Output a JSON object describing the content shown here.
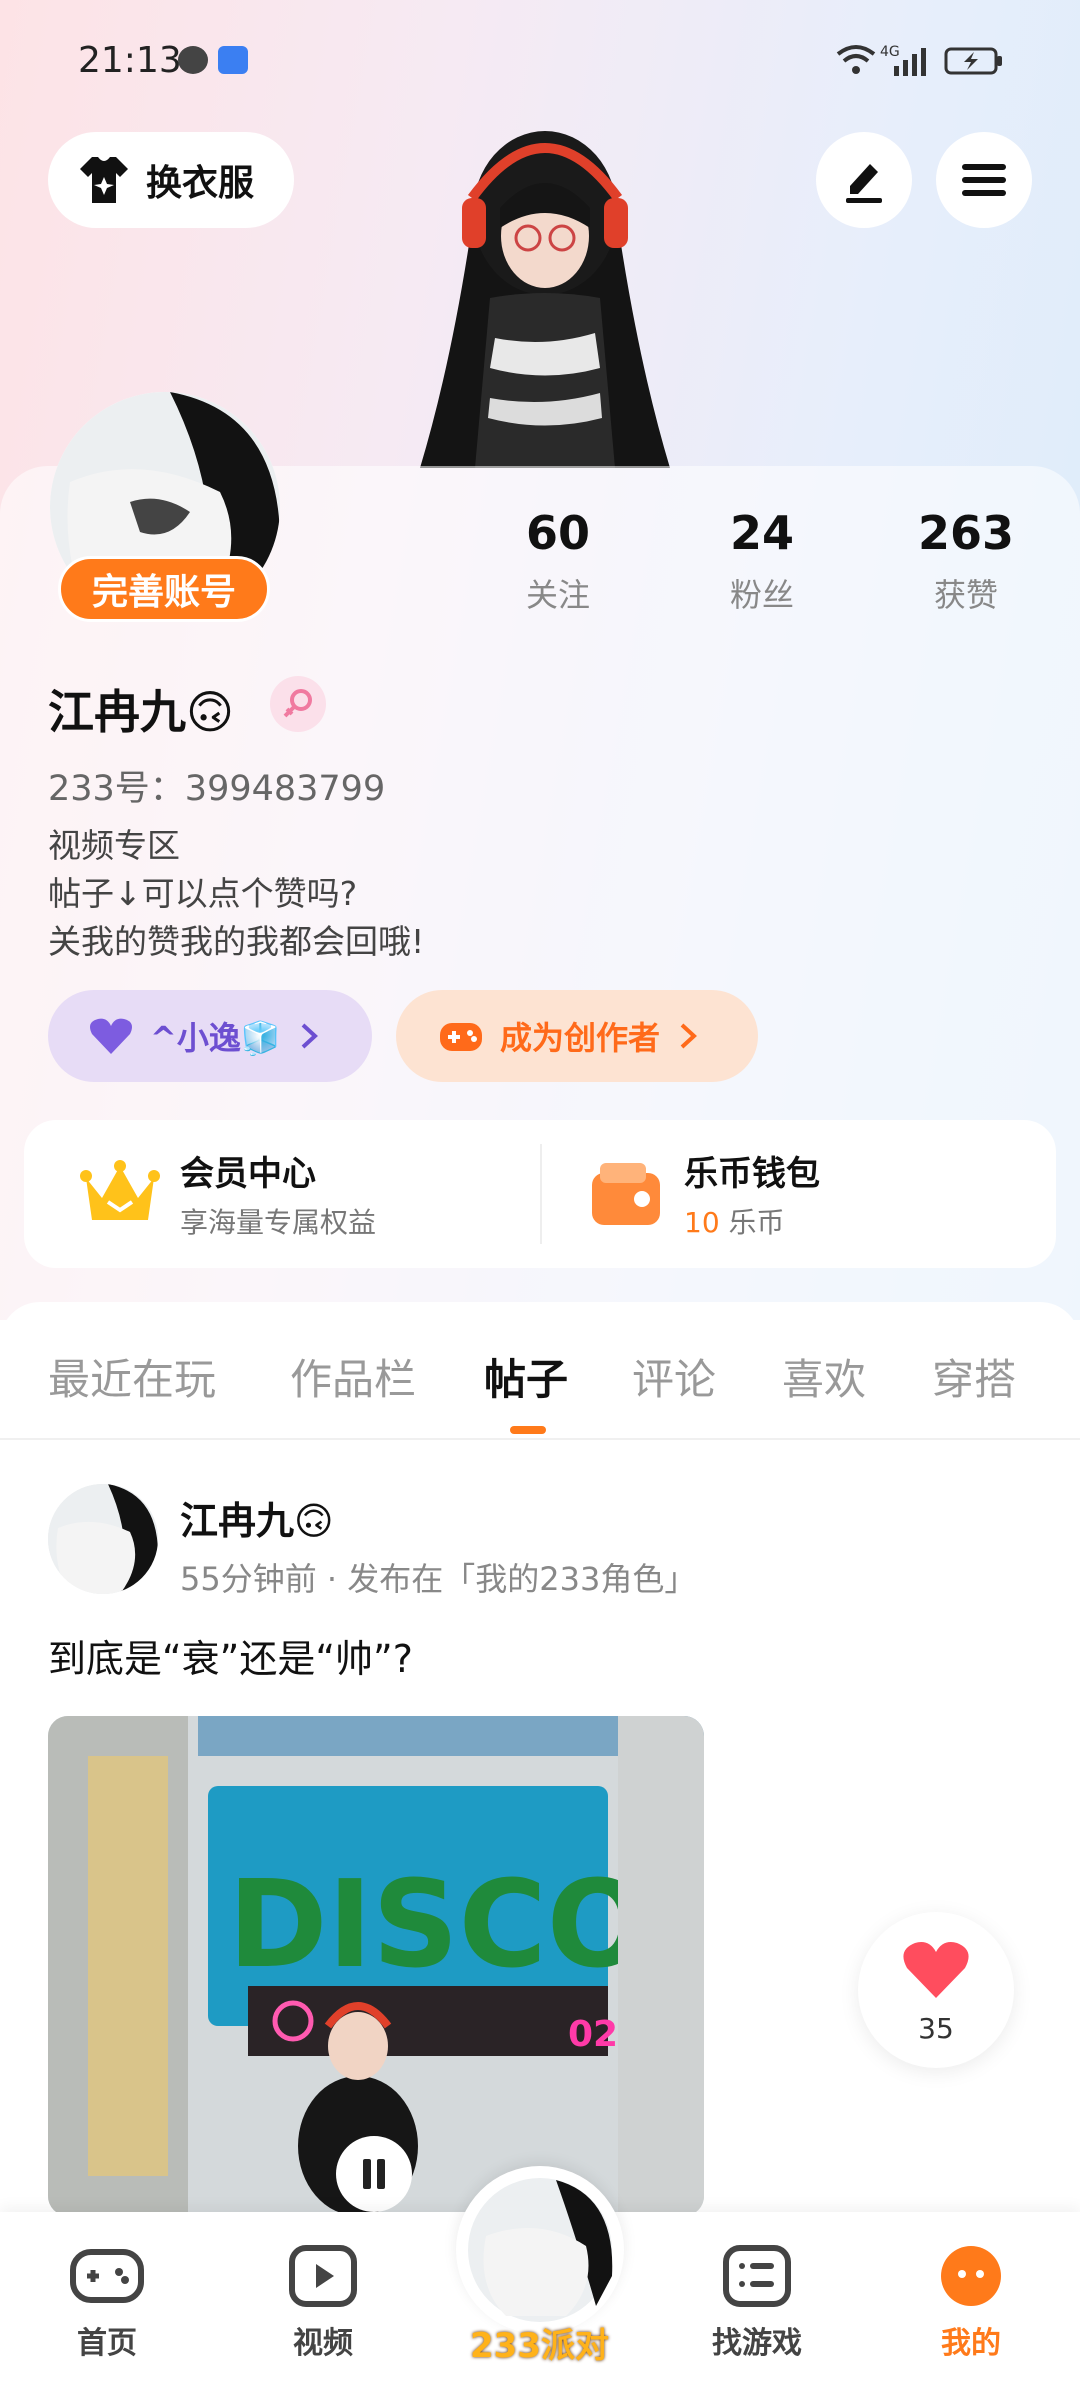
{
  "status_bar": {
    "time": "21:13",
    "network": "4G"
  },
  "header": {
    "outfit_label": "换衣服"
  },
  "profile": {
    "complete_label": "完善账号",
    "stats": [
      {
        "num": "60",
        "label": "关注"
      },
      {
        "num": "24",
        "label": "粉丝"
      },
      {
        "num": "263",
        "label": "获赞"
      }
    ],
    "name": "江冉九🙃",
    "uid": "233号：399483799",
    "bio": [
      "视频专区",
      "帖子↓可以点个赞吗?",
      "关我的赞我的我都会回哦!"
    ],
    "fan_badge": "^小逸🧊",
    "creator_label": "成为创作者"
  },
  "vip": {
    "member_title": "会员中心",
    "member_sub": "享海量专属权益",
    "wallet_title": "乐币钱包",
    "wallet_amount": "10",
    "wallet_unit": " 乐币"
  },
  "tabs": [
    "最近在玩",
    "作品栏",
    "帖子",
    "评论",
    "喜欢",
    "穿搭"
  ],
  "active_tab": "帖子",
  "post": {
    "author": "江冉九🙃",
    "meta": "55分钟前 · 发布在「我的233角色」",
    "text": "到底是“衰”还是“帅”?",
    "media_sign": "DISCO",
    "media_num": "02",
    "likes": "35"
  },
  "nav": {
    "home": "首页",
    "video": "视频",
    "party": "233派对",
    "games": "找游戏",
    "mine": "我的"
  },
  "colors": {
    "accent": "#ff7a1a",
    "fan_purple": "#6d4fd1"
  }
}
